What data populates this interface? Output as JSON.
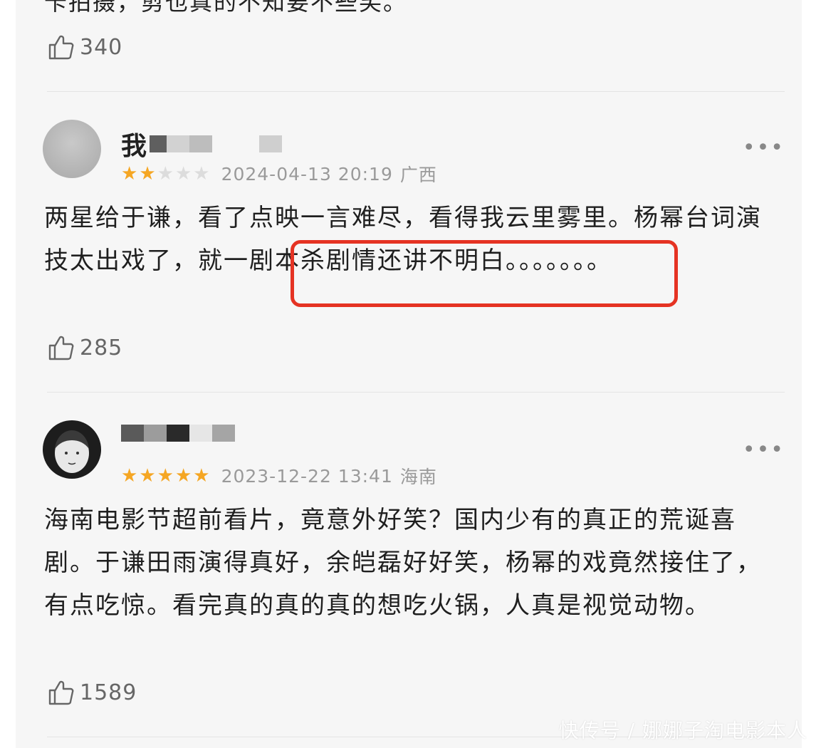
{
  "top_comment": {
    "text_partial": "卡拍摄，剪也真的不知要不些笑。",
    "likes": "340"
  },
  "reviews": [
    {
      "username_visible": "我",
      "stars": 2,
      "date": "2024-04-13 20:19",
      "location": "广西",
      "text": "两星给于谦，看了点映一言难尽，看得我云里雾里。杨幂台词演技太出戏了，就一剧本杀剧情还讲不明白。。。。。。。",
      "likes": "285",
      "highlight": "就一剧本杀剧情还讲不明"
    },
    {
      "username_visible": "",
      "stars": 5,
      "date": "2023-12-22 13:41",
      "location": "海南",
      "text": "海南电影节超前看片，竟意外好笑？国内少有的真正的荒诞喜剧。于谦田雨演得真好，余皑磊好好笑，杨幂的戏竟然接住了，有点吃惊。看完真的真的真的想吃火锅，人真是视觉动物。",
      "likes": "1589"
    }
  ],
  "more_label": "•••",
  "watermark": "快传号 / 娜娜子淘电影本人",
  "colors": {
    "star_on": "#f5a623",
    "star_off": "#dcdcdc",
    "highlight_border": "#e53323"
  }
}
